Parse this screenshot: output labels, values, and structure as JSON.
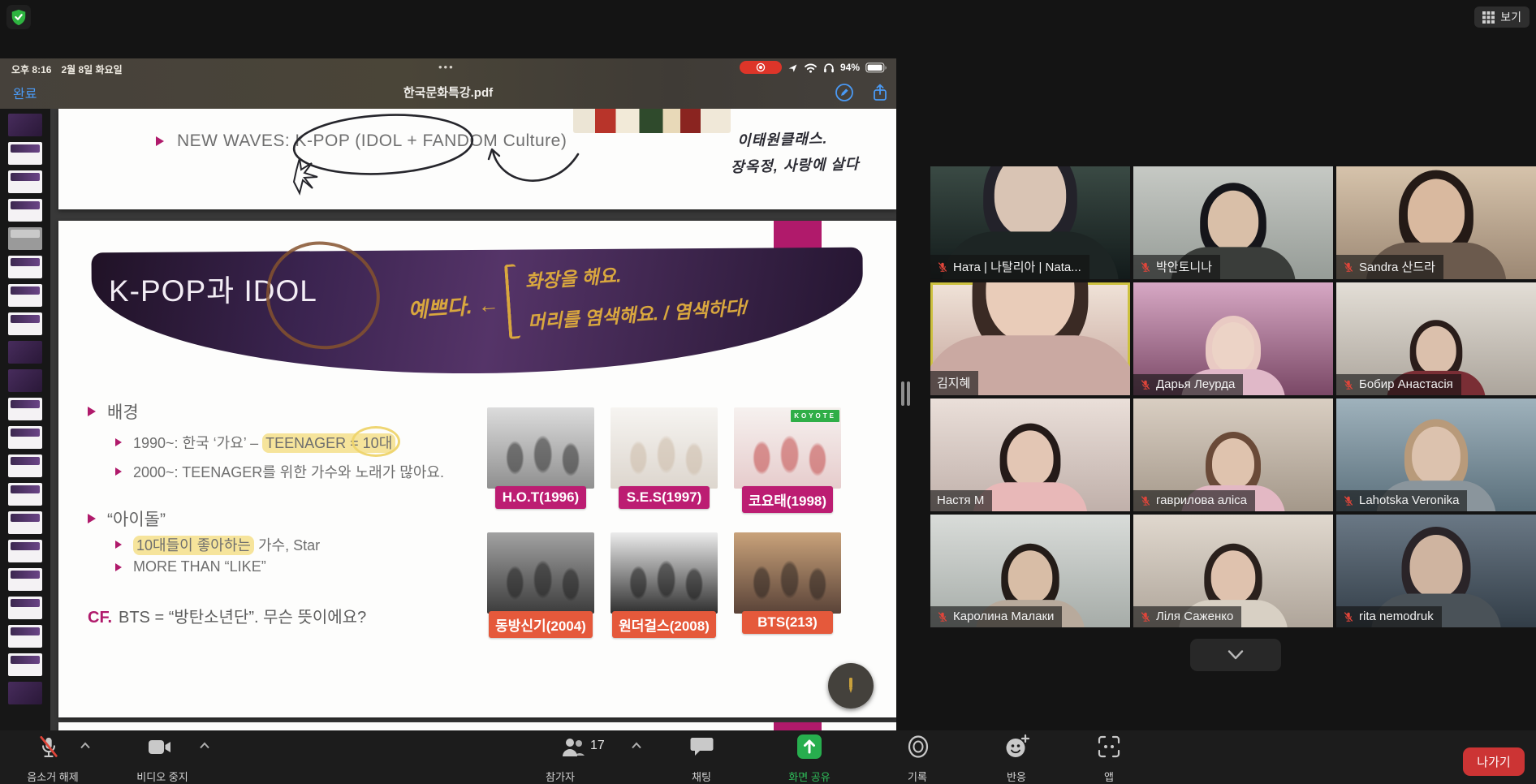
{
  "window": {
    "view_label": "보기"
  },
  "ipad": {
    "time": "오후 8:16",
    "date": "2월 8일 화요일",
    "dots": "•••",
    "battery": "94%",
    "done": "완료",
    "title": "한국문화특강.pdf"
  },
  "pdf": {
    "sidebar": {
      "count": 21,
      "selected_index": 4
    },
    "top_slide": {
      "bullet": "NEW WAVES: K-POP (IDOL + FANDOM Culture)",
      "hw1": "이태원클래스.",
      "hw2": "장옥정, 사랑에 살다"
    },
    "main_slide": {
      "title": "K-POP과 IDOL",
      "annotation": {
        "lead": "예쁘다. ←",
        "line1": "화장을 해요.",
        "line2": "머리를 염색해요.  / 염색하다/"
      },
      "bullets": {
        "h1": "배경",
        "b1_pre": "1990~: 한국 ‘가요’ – ",
        "b1_hl": "TEENAGER = 10대",
        "b2": "2000~: TEENAGER를 위한 가수와 노래가 많아요.",
        "h2": "“아이돌”",
        "b3_hl": "10대들이 좋아하는",
        "b3_post": " 가수, Star",
        "b4": "MORE THAN “LIKE”",
        "cf_label": "CF.",
        "cf_text": "BTS = “방탄소년단”. 무슨 뜻이에요?"
      },
      "albums": [
        {
          "label": "H.O.T(1996)",
          "p1": "#dcdcdc",
          "p2": "#8f8f8f",
          "fig": "#2a2a2a"
        },
        {
          "label": "S.E.S(1997)",
          "p1": "#f6f4f1",
          "p2": "#ddd6ce",
          "fig": "#cbb9a5"
        },
        {
          "label": "코요태(1998)",
          "p1": "#f6f1ef",
          "p2": "#e6cccc",
          "fig": "#c04040",
          "banner": "KOYOTE"
        },
        {
          "label": "동방신기(2004)",
          "p1": "#a2a2a2",
          "p2": "#3c3c3c",
          "fig": "#1e1e1e"
        },
        {
          "label": "원더걸스(2008)",
          "p1": "#ececec",
          "p2": "#2f2f2f",
          "fig": "#161616"
        },
        {
          "label": "BTS(213)",
          "p1": "#c9a27a",
          "p2": "#5a4338",
          "fig": "#26201e"
        }
      ]
    }
  },
  "participants": {
    "tiles": [
      {
        "name": "Ната | 나탈리아 | Nata...",
        "muted": true,
        "active": false,
        "c1": "#3a4a44",
        "c2": "#121a1a",
        "skin": "#d9c4b4",
        "hair": "#23222a",
        "shirt": "#1d2524"
      },
      {
        "name": "박안토니나",
        "muted": true,
        "active": false,
        "c1": "#c6c9c4",
        "c2": "#969c97",
        "skin": "#d9bfa8",
        "hair": "#15151a",
        "shirt": "#3a3d3a"
      },
      {
        "name": "Sandra 산드라",
        "muted": true,
        "active": false,
        "c1": "#d6c3ab",
        "c2": "#9c8874",
        "skin": "#d9b99f",
        "hair": "#241a16",
        "shirt": "#6b5a4d"
      },
      {
        "name": "김지혜",
        "muted": false,
        "active": true,
        "c1": "#f0e3d8",
        "c2": "#c4a49b",
        "skin": "#e9ccb9",
        "hair": "#3a2a24",
        "shirt": "#caa9a2"
      },
      {
        "name": "Дарья Леурда",
        "muted": true,
        "active": false,
        "c1": "#d7a8c4",
        "c2": "#7a4866",
        "skin": "#ecd3c6",
        "hair": "#e9cac3",
        "shirt": "#e0b8c8"
      },
      {
        "name": "Бобир Анастасія",
        "muted": true,
        "active": false,
        "c1": "#e3ded6",
        "c2": "#aca59c",
        "skin": "#dbc0ac",
        "hair": "#2a1d1a",
        "shirt": "#7a2e35"
      },
      {
        "name": "Настя M",
        "muted": false,
        "active": false,
        "c1": "#eadfd9",
        "c2": "#c0b0aa",
        "skin": "#e3c6b4",
        "hair": "#241a18",
        "shirt": "#e8b8b8"
      },
      {
        "name": "гаврилова аліса",
        "muted": true,
        "active": false,
        "c1": "#d9cec2",
        "c2": "#a4988a",
        "skin": "#dfc3ae",
        "hair": "#6a4a38",
        "shirt": "#e3b8c4"
      },
      {
        "name": "Lahotska Veronika",
        "muted": true,
        "active": false,
        "c1": "#9fb2bc",
        "c2": "#5b707c",
        "skin": "#dcc2ae",
        "hair": "#b89a7a",
        "shirt": "#8a959c"
      },
      {
        "name": "Каролина Малаки",
        "muted": true,
        "active": false,
        "c1": "#d9dcd9",
        "c2": "#a6aca8",
        "skin": "#d8bda6",
        "hair": "#241c18",
        "shirt": "#b8aa9c"
      },
      {
        "name": "Ліля Саженко",
        "muted": true,
        "active": false,
        "c1": "#e0d8ce",
        "c2": "#afa59a",
        "skin": "#dfc2ae",
        "hair": "#2a201c",
        "shirt": "#d8d0c4"
      },
      {
        "name": "rita nemodruk",
        "muted": true,
        "active": false,
        "c1": "#6a7885",
        "c2": "#333e48",
        "skin": "#cfb4a0",
        "hair": "#2a2428",
        "shirt": "#4a5258"
      }
    ]
  },
  "toolbar": {
    "mute": "음소거 해제",
    "video": "비디오 중지",
    "participants": "참가자",
    "participants_count": "17",
    "chat": "채팅",
    "share": "화면 공유",
    "record": "기록",
    "reactions": "반응",
    "apps": "앱",
    "leave": "나가기"
  },
  "colors": {
    "magenta": "#b01a6b",
    "orange_label": "#e5593b",
    "highlight": "#f6e49b",
    "gold": "#d9a73e",
    "ios_blue": "#4a9af5",
    "share_green": "#27ae4e",
    "leave_red": "#cc3434",
    "mute_red": "#e0453a",
    "active_border": "#cdc13f"
  }
}
